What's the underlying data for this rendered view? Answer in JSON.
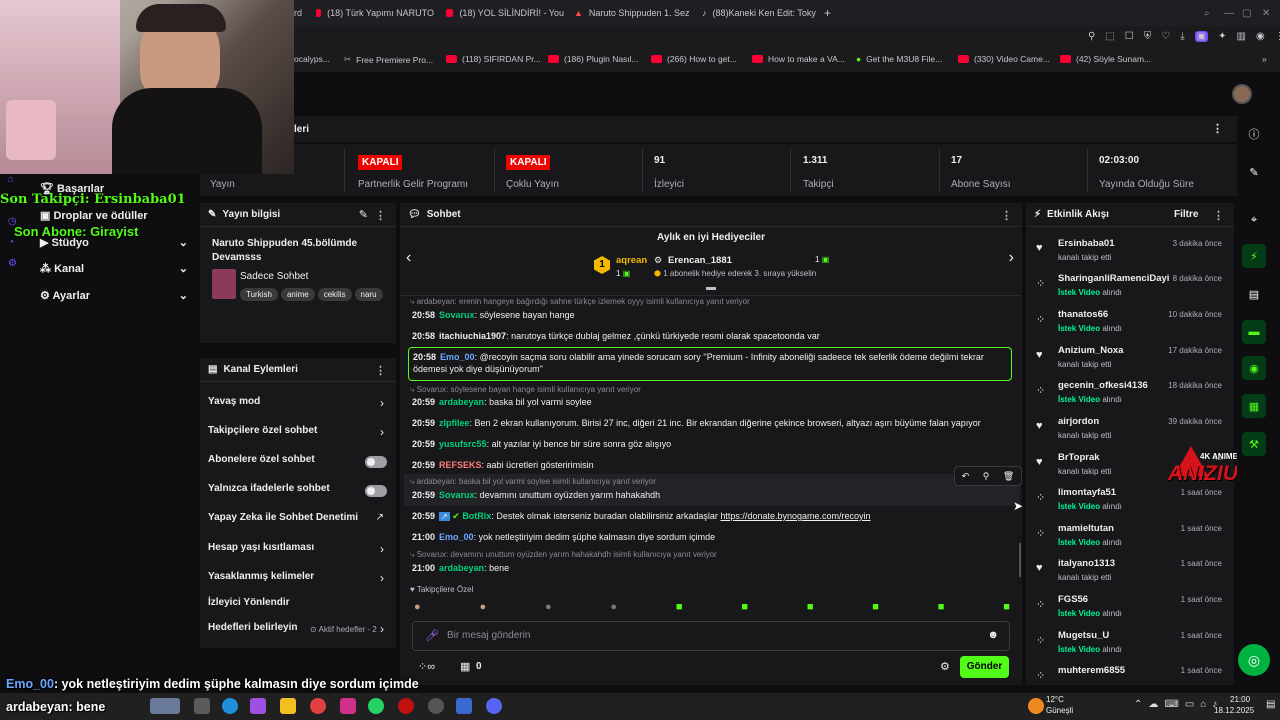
{
  "tabs": [
    "rd",
    "(18) Türk Yapımı NARUTO",
    "(18) YOL SİLİNDİRİ! - You",
    "Naruto Shippuden 1. Sez",
    "(88)Kaneki Ken Edit: Toky"
  ],
  "bookmarks": [
    "ocalyps...",
    "Free Premiere Pro...",
    "(118) SIFIRDAN Pr...",
    "(186) Plugin Nasıl...",
    "(266) How to get...",
    "How to make a VA...",
    "Get the M3U8 File...",
    "(330) Video Came...",
    "(42) Söyle Sunam..."
  ],
  "stream_overlay": {
    "last_follower": "Son Takipçi: Ersinbaba01",
    "last_sub": "Son Abone: Girayist",
    "chat1_user": "Emo_00",
    "chat1_text": ": yok netleştiriyim dedim şüphe kalmasın diye sordum içimde",
    "chat2_user": "ardabeyan",
    "chat2_text": ": bene",
    "logo": "ANIZIUM",
    "logo_top": "4K ANIME MOVIE"
  },
  "sidenav": {
    "items": [
      "Başarılar",
      "Droplar ve ödüller",
      "Stüdyo",
      "Kanal",
      "Ayarlar"
    ]
  },
  "stats_title": "leri",
  "stats": [
    {
      "value": "",
      "label": "Yayın"
    },
    {
      "value": "KAPALI",
      "label": "Partnerlik Gelir Programı"
    },
    {
      "value": "KAPALI",
      "label": "Çoklu Yayın"
    },
    {
      "value": "91",
      "label": "İzleyici"
    },
    {
      "value": "1.311",
      "label": "Takipçi"
    },
    {
      "value": "17",
      "label": "Abone Sayısı"
    },
    {
      "value": "02:03:00",
      "label": "Yayında Olduğu Süre"
    }
  ],
  "stream_info": {
    "header": "Yayın bilgisi",
    "title": "Naruto Shippuden 45.bölümde Devamsss",
    "category": "Sadece Sohbet",
    "tags": [
      "Turkish",
      "anime",
      "cekilis",
      "naru"
    ]
  },
  "channel_actions": {
    "header": "Kanal Eylemleri",
    "items": [
      {
        "label": "Yavaş mod",
        "control": "chevron"
      },
      {
        "label": "Takipçilere özel sohbet",
        "control": "chevron"
      },
      {
        "label": "Abonelere özel sohbet",
        "control": "toggle"
      },
      {
        "label": "Yalnızca ifadelerle sohbet",
        "control": "toggle"
      },
      {
        "label": "Yapay Zeka ile Sohbet Denetimi",
        "control": "link"
      },
      {
        "label": "Hesap yaşı kısıtlaması",
        "control": "chevron"
      },
      {
        "label": "Yasaklanmış kelimeler",
        "control": "chevron"
      },
      {
        "label": "İzleyici Yönlendir",
        "control": "none"
      },
      {
        "label": "Hedefleri belirleyin",
        "control": "chevron",
        "extra": "Aktif hedefler - 2"
      }
    ]
  },
  "chat": {
    "header": "Sohbet",
    "gifter_title": "Aylık en iyi Hediyeciler",
    "gifter1": "aqrean",
    "gifter1_count": "1",
    "gifter2": "Erencan_1881",
    "gifter2_count": "1",
    "gifter_note": "1 abonelik hediye ederek 3. sıraya yükselin",
    "top_reply": "ardabeyan: erenin hangeye bağırdığı sahne türkçe izlemek oyyy isimli kullanıcıya yanıt veriyor",
    "messages": [
      {
        "time": "20:58",
        "user": "Sovarux",
        "color": "#00d17a",
        "text": ": söylesene bayan hange"
      },
      {
        "time": "20:58",
        "user": "itachiuchia1907",
        "color": "#efeff1",
        "text": ": narutoya türkçe dublaj gelmez ,çünkü türkiyede resmi olarak spacetoonda var"
      },
      {
        "time": "20:58",
        "user": "Emo_00",
        "color": "#6aa8ff",
        "text": ": @recoyin saçma soru olabilir ama yinede sorucam sory ''Premium - Infinity aboneliği sadeece tek seferlik ödeme değilmi tekrar ödemesi yok diye düşünüyorum''"
      },
      {
        "time": "20:59",
        "user": "ardabeyan",
        "color": "#00d17a",
        "text": ": baska bil yol varmi soylee",
        "reply": "Sovarux: söylesene bayan hange isimli kullanıcıya yanıt veriyor"
      },
      {
        "time": "20:59",
        "user": "zlpfilee",
        "color": "#00d17a",
        "text": ": Ben 2 ekran kullanıyorum. Birisi 27 inc, diğeri 21 inc. Bir ekrandan diğerine çekince browseri, altyazı aşırı büyüme falan yapıyor"
      },
      {
        "time": "20:59",
        "user": "yusufsrc55",
        "color": "#00d17a",
        "text": ": alt yazılar iyi bence bir süre sonra göz alışıyo"
      },
      {
        "time": "20:59",
        "user": "REFSEKS",
        "color": "#ff7b7b",
        "text": ": aabi ücretleri gösteririmisin"
      },
      {
        "time": "20:59",
        "user": "Sovarux",
        "color": "#00d17a",
        "text": ": devamını unuttum oyüzden yarım hahakahdh",
        "reply": "ardabeyan: baska bil yol varmi soylee isimli kullanıcıya yanıt veriyor"
      },
      {
        "time": "20:59",
        "user": "BotRix",
        "color": "#00d17a",
        "text": ": Destek olmak isterseniz buradan olabilirsiniz arkadaşlar ",
        "link": "https://donate.bynogame.com/recoyin"
      },
      {
        "time": "21:00",
        "user": "Emo_00",
        "color": "#6aa8ff",
        "text": ": yok netleştiriyim dedim şüphe kalmasın diye sordum içimde"
      },
      {
        "time": "21:00",
        "user": "ardabeyan",
        "color": "#00d17a",
        "text": ": bene",
        "reply": "Sovarux: devamını unuttum oyüzden yarım hahakahdh isimli kullanıcıya yanıt veriyor"
      }
    ],
    "followers_only": "Takipçilere Özel",
    "input_placeholder": "Bir mesaj gönderin",
    "points": "0",
    "send": "Gönder"
  },
  "activity": {
    "header": "Etkinlik Akışı",
    "filter": "Filtre",
    "items": [
      {
        "name": "Ersinbaba01",
        "sub": "kanalı takip etti",
        "time": "3 dakika önce",
        "kind": "follow"
      },
      {
        "name": "SharinganliRamenciDayi",
        "sub": "İstek Video",
        "sub2": " alındı",
        "time": "8 dakika önce",
        "kind": "reward"
      },
      {
        "name": "thanatos66",
        "sub": "İstek Video",
        "sub2": " alındı",
        "time": "10 dakika önce",
        "kind": "reward"
      },
      {
        "name": "Anizium_Noxa",
        "sub": "kanalı takip etti",
        "time": "17 dakika önce",
        "kind": "follow"
      },
      {
        "name": "gecenin_ofkesi4136",
        "sub": "İstek Video",
        "sub2": " alındı",
        "time": "18 dakika önce",
        "kind": "reward"
      },
      {
        "name": "airjordon",
        "sub": "kanalı takip etti",
        "time": "39 dakika önce",
        "kind": "follow"
      },
      {
        "name": "BrToprak",
        "sub": "kanalı takip etti",
        "time": "42",
        "kind": "follow"
      },
      {
        "name": "limontayfa51",
        "sub": "İstek Video",
        "sub2": " alındı",
        "time": "1 saat önce",
        "kind": "reward"
      },
      {
        "name": "mamieltutan",
        "sub": "İstek Video",
        "sub2": " alındı",
        "time": "1 saat önce",
        "kind": "reward"
      },
      {
        "name": "italyano1313",
        "sub": "kanalı takip etti",
        "time": "1 saat önce",
        "kind": "follow"
      },
      {
        "name": "FGS56",
        "sub": "İstek Video",
        "sub2": " alındı",
        "time": "1 saat önce",
        "kind": "reward"
      },
      {
        "name": "Mugetsu_U",
        "sub": "İstek Video",
        "sub2": " alındı",
        "time": "1 saat önce",
        "kind": "reward"
      },
      {
        "name": "muhterem6855",
        "sub": "",
        "time": "1 saat önce",
        "kind": "reward"
      }
    ]
  },
  "taskbar": {
    "weather_temp": "12°C",
    "weather_desc": "Güneşli",
    "time": "21:00",
    "date": "18.12.2025"
  },
  "colors": {
    "accent": "#53fc18",
    "bg": "#0e0e10",
    "panel": "#18181b",
    "red": "#eb0400",
    "teal": "#00d17a"
  }
}
